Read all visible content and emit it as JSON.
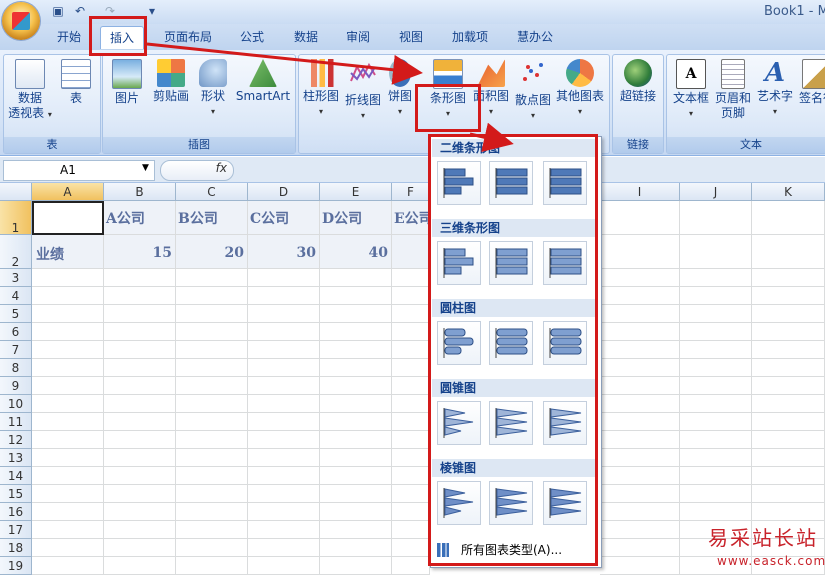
{
  "window": {
    "title": "Book1 - M"
  },
  "tabs": [
    {
      "label": "开始"
    },
    {
      "label": "插入"
    },
    {
      "label": "页面布局"
    },
    {
      "label": "公式"
    },
    {
      "label": "数据"
    },
    {
      "label": "审阅"
    },
    {
      "label": "视图"
    },
    {
      "label": "加载项"
    },
    {
      "label": "慧办公"
    }
  ],
  "ribbon": {
    "groups": {
      "table": "表",
      "illustrations": "插图",
      "links": "链接",
      "text": "文本"
    },
    "buttons": {
      "pivot_line1": "数据",
      "pivot_line2": "透视表",
      "table": "表",
      "picture": "图片",
      "clipart": "剪贴画",
      "shapes": "形状",
      "smartart": "SmartArt",
      "column_chart": "柱形图",
      "line_chart": "折线图",
      "pie_chart": "饼图",
      "bar_chart": "条形图",
      "area_chart": "面积图",
      "scatter_chart": "散点图",
      "other_charts": "其他图表",
      "hyperlink": "超链接",
      "textbox": "文本框",
      "header_line1": "页眉和",
      "header_line2": "页脚",
      "wordart": "艺术字",
      "signature": "签名行"
    }
  },
  "formula_bar": {
    "name_box": "A1",
    "fx": "fx"
  },
  "columns": [
    "A",
    "B",
    "C",
    "D",
    "E",
    "F",
    "I",
    "J",
    "K"
  ],
  "rows": [
    "1",
    "2",
    "3",
    "4",
    "5",
    "6",
    "7",
    "8",
    "9",
    "10",
    "11",
    "12",
    "13",
    "14",
    "15",
    "16",
    "17",
    "18",
    "19"
  ],
  "cells": {
    "B1": "A公司",
    "C1": "B公司",
    "D1": "C公司",
    "E1": "D公司",
    "F1": "E公司",
    "A2": "业绩",
    "B2": "15",
    "C2": "20",
    "D2": "30",
    "E2": "40"
  },
  "gallery": {
    "sections": [
      "二维条形图",
      "三维条形图",
      "圆柱图",
      "圆锥图",
      "棱锥图"
    ],
    "all_types": "所有图表类型(A)..."
  },
  "watermark": {
    "text": "易采站长站",
    "url": "www.easck.com"
  },
  "colors": {
    "annotation": "#d31a1a",
    "ribbon": "#d3e2f6",
    "accent": "#15428b"
  }
}
